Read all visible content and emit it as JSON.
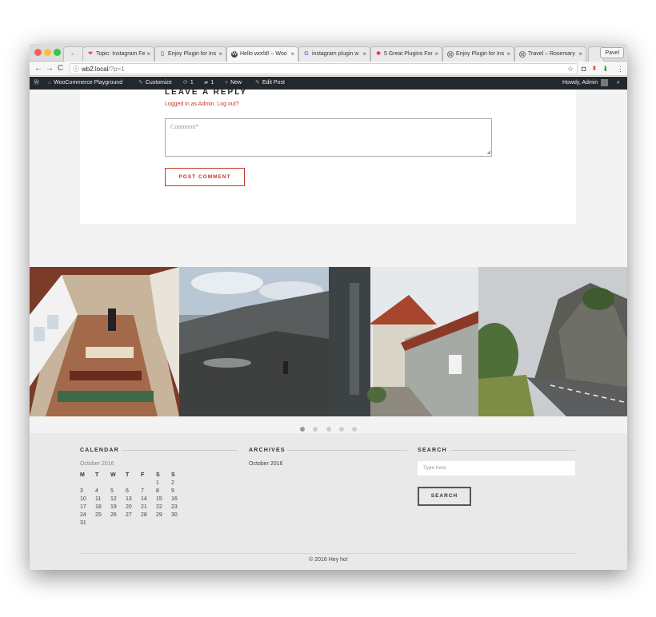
{
  "browser": {
    "tabs": [
      {
        "icon": "←",
        "label": ""
      },
      {
        "icon": "❤",
        "label": "Topic: Instagram Fe"
      },
      {
        "icon": "▯",
        "label": "Enjoy Plugin for Ins"
      },
      {
        "icon": "W",
        "label": "Hello world! – Woo"
      },
      {
        "icon": "G",
        "label": "instagram plugin w"
      },
      {
        "icon": "✱",
        "label": "5 Great Plugins For"
      },
      {
        "icon": "W",
        "label": "Enjoy Plugin for Ins"
      },
      {
        "icon": "W",
        "label": "Travel – Rosemary"
      }
    ],
    "profile": "Pavel",
    "url_host": "wb2.local",
    "url_path": "/?p=1"
  },
  "adminbar": {
    "site": "WooCommerce Playground",
    "customize": "Customize",
    "updates": "1",
    "comments": "1",
    "new": "New",
    "edit": "Edit Post",
    "howdy": "Howdy, Admin"
  },
  "reply": {
    "title": "LEAVE A REPLY",
    "logged_in": "Logged in as Admin. Log out?",
    "comment_placeholder": "Comment*",
    "post_button": "POST COMMENT"
  },
  "footer": {
    "calendar": {
      "title": "CALENDAR",
      "month": "October 2016",
      "days": [
        "M",
        "T",
        "W",
        "T",
        "F",
        "S",
        "S"
      ],
      "weeks": [
        [
          "",
          "",
          "",
          "",
          "",
          "1",
          "2"
        ],
        [
          "3",
          "4",
          "5",
          "6",
          "7",
          "8",
          "9"
        ],
        [
          "10",
          "11",
          "12",
          "13",
          "14",
          "15",
          "16"
        ],
        [
          "17",
          "18",
          "19",
          "20",
          "21",
          "22",
          "23"
        ],
        [
          "24",
          "25",
          "26",
          "27",
          "28",
          "29",
          "30"
        ],
        [
          "31",
          "",
          "",
          "",
          "",
          "",
          ""
        ]
      ]
    },
    "archives": {
      "title": "ARCHIVES",
      "link": "October 2016"
    },
    "search": {
      "title": "SEARCH",
      "placeholder": "Type here",
      "button": "SEARCH"
    },
    "copyright": "© 2016 Hey ho!"
  }
}
